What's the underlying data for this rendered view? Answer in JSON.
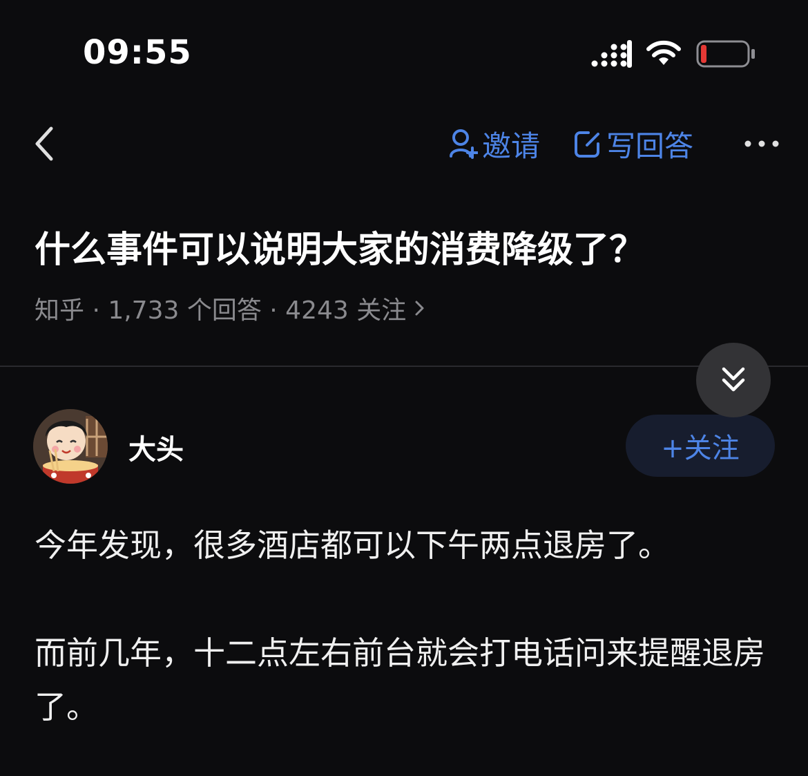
{
  "status_bar": {
    "time": "09:55",
    "battery_color": "#e53935"
  },
  "nav": {
    "back_icon": "chevron-left-icon",
    "invite_label": "邀请",
    "write_answer_label": "写回答",
    "more_icon": "more-horizontal-icon",
    "accent_color": "#4d84e6"
  },
  "question": {
    "title": "什么事件可以说明大家的消费降级了？",
    "meta": "知乎 · 1,733 个回答 · 4243 关注"
  },
  "answer": {
    "author_name": "大头",
    "follow_label": "+关注",
    "paragraphs": [
      "今年发现，很多酒店都可以下午两点退房了。",
      "而前几年，十二点左右前台就会打电话问来提醒退房了。"
    ]
  }
}
